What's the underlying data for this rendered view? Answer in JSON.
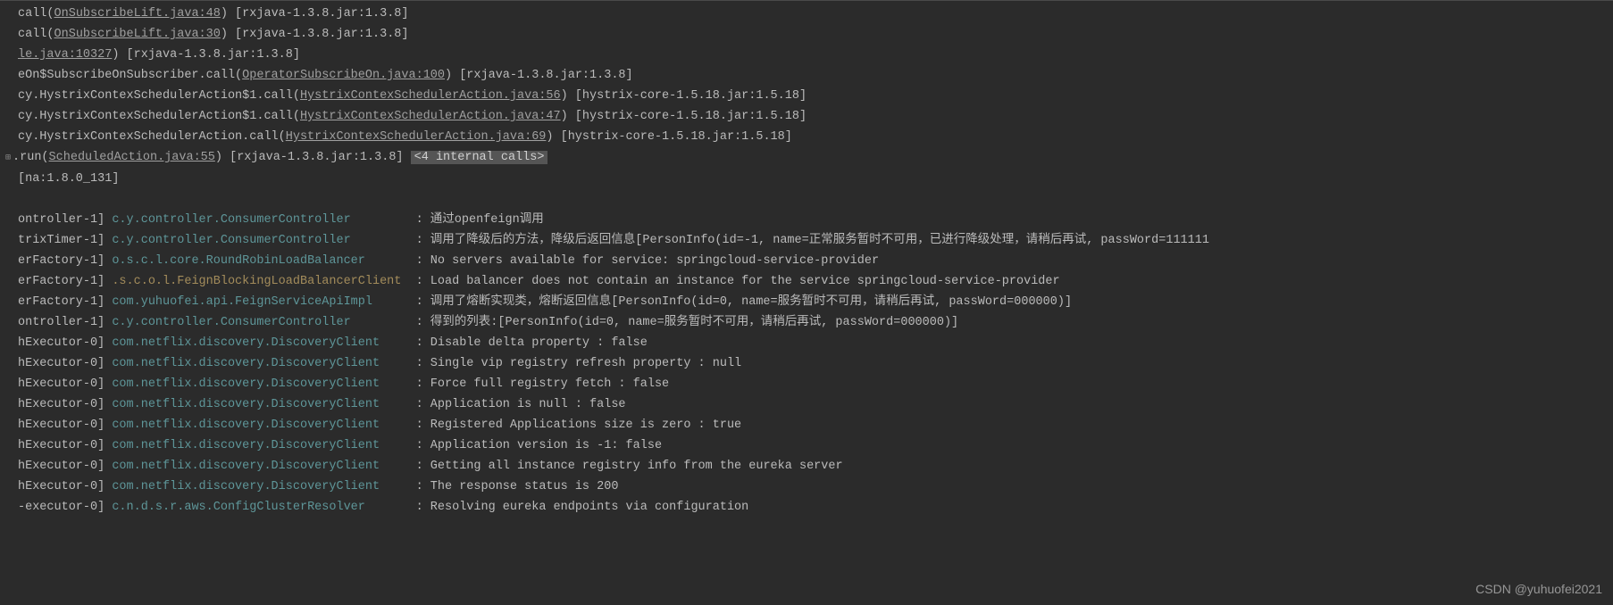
{
  "stack": [
    {
      "pre": "call(",
      "link": "OnSubscribeLift.java:48",
      "post": ") [rxjava-1.3.8.jar:1.3.8]"
    },
    {
      "pre": "call(",
      "link": "OnSubscribeLift.java:30",
      "post": ") [rxjava-1.3.8.jar:1.3.8]"
    },
    {
      "link": "le.java:10327",
      "post": ") [rxjava-1.3.8.jar:1.3.8]"
    },
    {
      "pre": "eOn$SubscribeOnSubscriber.call(",
      "link": "OperatorSubscribeOn.java:100",
      "post": ") [rxjava-1.3.8.jar:1.3.8]"
    },
    {
      "pre": "cy.HystrixContexSchedulerAction$1.call(",
      "link": "HystrixContexSchedulerAction.java:56",
      "post": ") [hystrix-core-1.5.18.jar:1.5.18]"
    },
    {
      "pre": "cy.HystrixContexSchedulerAction$1.call(",
      "link": "HystrixContexSchedulerAction.java:47",
      "post": ") [hystrix-core-1.5.18.jar:1.5.18]"
    },
    {
      "pre": "cy.HystrixContexSchedulerAction.call(",
      "link": "HystrixContexSchedulerAction.java:69",
      "post": ") [hystrix-core-1.5.18.jar:1.5.18]"
    }
  ],
  "run_line": {
    "toggle": "⊞",
    "pre": ".run(",
    "link": "ScheduledAction.java:55",
    "post": ") [rxjava-1.3.8.jar:1.3.8] ",
    "badge": "<4 internal calls>"
  },
  "na_line": "[na:1.8.0_131]",
  "log_lines": [
    {
      "thread": "ontroller-1]",
      "logger": "c.y.controller.ConsumerController",
      "style": "logger",
      "msg": "通过openfeign调用"
    },
    {
      "thread": "trixTimer-1]",
      "logger": "c.y.controller.ConsumerController",
      "style": "logger",
      "msg": "调用了降级后的方法，降级后返回信息[PersonInfo(id=-1, name=正常服务暂时不可用，已进行降级处理，请稍后再试, passWord=111111"
    },
    {
      "thread": "erFactory-1]",
      "logger": "o.s.c.l.core.RoundRobinLoadBalancer",
      "style": "logger",
      "msg": "No servers available for service: springcloud-service-provider"
    },
    {
      "thread": "erFactory-1]",
      "logger": ".s.c.o.l.FeignBlockingLoadBalancerClient",
      "style": "yellow-logger",
      "msg": "Load balancer does not contain an instance for the service springcloud-service-provider"
    },
    {
      "thread": "erFactory-1]",
      "logger": "com.yuhuofei.api.FeignServiceApiImpl",
      "style": "logger",
      "msg": "调用了熔断实现类，熔断返回信息[PersonInfo(id=0, name=服务暂时不可用，请稍后再试, passWord=000000)]"
    },
    {
      "thread": "ontroller-1]",
      "logger": "c.y.controller.ConsumerController",
      "style": "logger",
      "msg": "得到的列表:[PersonInfo(id=0, name=服务暂时不可用，请稍后再试, passWord=000000)]"
    },
    {
      "thread": "hExecutor-0]",
      "logger": "com.netflix.discovery.DiscoveryClient",
      "style": "logger",
      "msg": "Disable delta property : false"
    },
    {
      "thread": "hExecutor-0]",
      "logger": "com.netflix.discovery.DiscoveryClient",
      "style": "logger",
      "msg": "Single vip registry refresh property : null"
    },
    {
      "thread": "hExecutor-0]",
      "logger": "com.netflix.discovery.DiscoveryClient",
      "style": "logger",
      "msg": "Force full registry fetch : false"
    },
    {
      "thread": "hExecutor-0]",
      "logger": "com.netflix.discovery.DiscoveryClient",
      "style": "logger",
      "msg": "Application is null : false"
    },
    {
      "thread": "hExecutor-0]",
      "logger": "com.netflix.discovery.DiscoveryClient",
      "style": "logger",
      "msg": "Registered Applications size is zero : true"
    },
    {
      "thread": "hExecutor-0]",
      "logger": "com.netflix.discovery.DiscoveryClient",
      "style": "logger",
      "msg": "Application version is -1: false"
    },
    {
      "thread": "hExecutor-0]",
      "logger": "com.netflix.discovery.DiscoveryClient",
      "style": "logger",
      "msg": "Getting all instance registry info from the eureka server"
    },
    {
      "thread": "hExecutor-0]",
      "logger": "com.netflix.discovery.DiscoveryClient",
      "style": "logger",
      "msg": "The response status is 200"
    },
    {
      "thread": "-executor-0]",
      "logger": "c.n.d.s.r.aws.ConfigClusterResolver",
      "style": "logger",
      "msg": "Resolving eureka endpoints via configuration"
    }
  ],
  "logger_col_width": 42,
  "watermark": "CSDN @yuhuofei2021"
}
